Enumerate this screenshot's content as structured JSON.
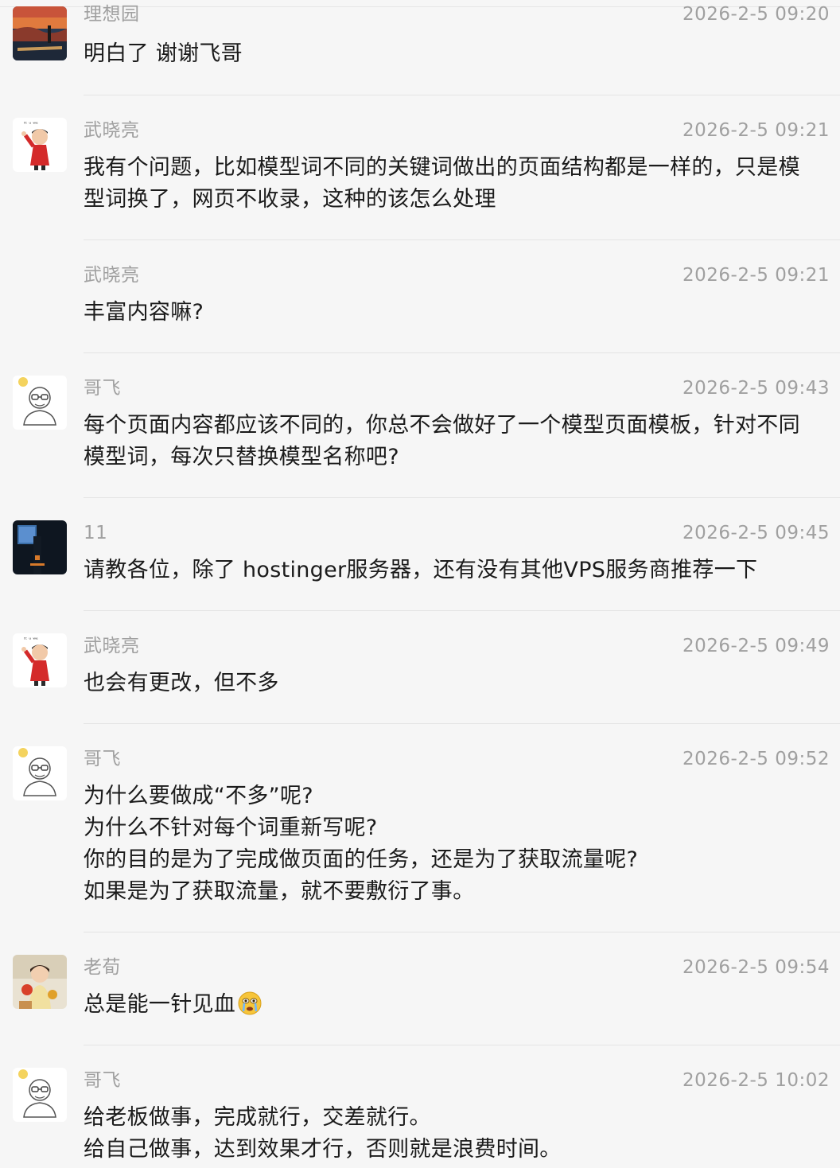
{
  "messages": [
    {
      "name": "理想园",
      "time": "2026-2-5 09:20",
      "lines": [
        "明白了 谢谢飞哥"
      ],
      "avatar": "sunset-avatar-icon"
    },
    {
      "name": "武晓亮",
      "time": "2026-2-5 09:21",
      "lines": [
        "我有个问题，比如模型词不同的关键词做出的页面结构都是一样的，只是模",
        "型词换了，网页不收录，这种的该怎么处理"
      ],
      "avatar": "cartoon-red-kid-avatar-icon"
    },
    {
      "name": "武晓亮",
      "time": "2026-2-5 09:21",
      "lines": [
        "丰富内容嘛?"
      ],
      "avatar": ""
    },
    {
      "name": "哥飞",
      "time": "2026-2-5 09:43",
      "lines": [
        "每个页面内容都应该不同的，你总不会做好了一个模型页面模板，针对不同",
        "模型词，每次只替换模型名称吧?"
      ],
      "avatar": "glasses-man-sketch-avatar-icon"
    },
    {
      "name": "11",
      "time": "2026-2-5 09:45",
      "lines": [
        "请教各位，除了 hostinger服务器，还有没有其他VPS服务商推荐一下"
      ],
      "avatar": "dark-tower-avatar-icon"
    },
    {
      "name": "武晓亮",
      "time": "2026-2-5 09:49",
      "lines": [
        "也会有更改，但不多"
      ],
      "avatar": "cartoon-red-kid-avatar-icon"
    },
    {
      "name": "哥飞",
      "time": "2026-2-5 09:52",
      "lines": [
        "为什么要做成“不多”呢?",
        "为什么不针对每个词重新写呢?",
        "你的目的是为了完成做页面的任务，还是为了获取流量呢?",
        "如果是为了获取流量，就不要敷衍了事。"
      ],
      "avatar": "glasses-man-sketch-avatar-icon"
    },
    {
      "name": "老荀",
      "time": "2026-2-5 09:54",
      "lines": [
        "总是能一针见血"
      ],
      "avatar": "girl-with-fruit-avatar-icon",
      "emoji": "crying-emoji-icon"
    },
    {
      "name": "哥飞",
      "time": "2026-2-5 10:02",
      "lines": [
        "给老板做事，完成就行，交差就行。",
        "给自己做事，达到效果才行，否则就是浪费时间。"
      ],
      "avatar": "glasses-man-sketch-avatar-icon"
    }
  ]
}
